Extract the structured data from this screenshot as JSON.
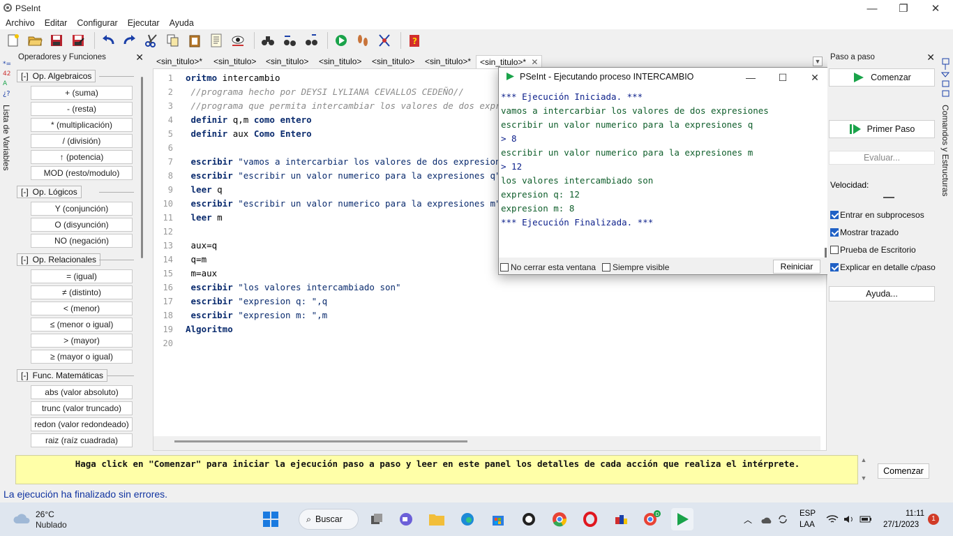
{
  "app": {
    "title": "PSeInt"
  },
  "menu": [
    "Archivo",
    "Editar",
    "Configurar",
    "Ejecutar",
    "Ayuda"
  ],
  "vars_panel": {
    "label": "Lista de Variables"
  },
  "ops_panel": {
    "title": "Operadores y Funciones",
    "groups": [
      {
        "label": "Op. Algebraicos",
        "toggle": "[-]",
        "items": [
          "+ (suma)",
          "- (resta)",
          "* (multiplicación)",
          "/ (división)",
          "↑ (potencia)",
          "MOD (resto/modulo)"
        ]
      },
      {
        "label": "Op. Lógicos",
        "toggle": "[-]",
        "items": [
          "Y (conjunción)",
          "O (disyunción)",
          "NO (negación)"
        ]
      },
      {
        "label": "Op. Relacionales",
        "toggle": "[-]",
        "items": [
          "= (igual)",
          "≠ (distinto)",
          "< (menor)",
          "≤ (menor o igual)",
          "> (mayor)",
          "≥ (mayor o igual)"
        ]
      },
      {
        "label": "Func. Matemáticas",
        "toggle": "[-]",
        "items": [
          "abs (valor absoluto)",
          "trunc (valor truncado)",
          "redon (valor redondeado)",
          "raiz (raíz cuadrada)"
        ]
      }
    ]
  },
  "tabs": [
    "<sin_titulo>*",
    "<sin_titulo>",
    "<sin_titulo>",
    "<sin_titulo>",
    "<sin_titulo>",
    "<sin_titulo>*",
    "<sin_titulo>*"
  ],
  "editor": {
    "line_numbers": [
      "1",
      "2",
      "3",
      "4",
      "5",
      "6",
      "7",
      "8",
      "9",
      "10",
      "11",
      "12",
      "13",
      "14",
      "15",
      "16",
      "17",
      "18",
      "19",
      "20"
    ],
    "lines": [
      [
        {
          "t": "oritmo",
          "c": "kw"
        },
        {
          "t": " intercambio",
          "c": ""
        }
      ],
      [
        {
          "t": " //programa hecho por DEYSI LYLIANA CEVALLOS CEDEÑO//",
          "c": "cm"
        }
      ],
      [
        {
          "t": " //programa que permita intercambiar los valores de dos expresiones",
          "c": "cm"
        }
      ],
      [
        {
          "t": " definir",
          "c": "kw"
        },
        {
          "t": " q,m ",
          "c": ""
        },
        {
          "t": "como entero",
          "c": "kw"
        }
      ],
      [
        {
          "t": " definir",
          "c": "kw"
        },
        {
          "t": " aux ",
          "c": ""
        },
        {
          "t": "Como Entero",
          "c": "kw"
        }
      ],
      [],
      [
        {
          "t": " escribir",
          "c": "kw"
        },
        {
          "t": " \"vamos a intercarbiar los valores de dos expresiones\"",
          "c": "str"
        }
      ],
      [
        {
          "t": " escribir",
          "c": "kw"
        },
        {
          "t": " \"escribir un valor numerico para la expresiones q\"",
          "c": "str"
        }
      ],
      [
        {
          "t": " leer",
          "c": "kw"
        },
        {
          "t": " q",
          "c": ""
        }
      ],
      [
        {
          "t": " escribir",
          "c": "kw"
        },
        {
          "t": " \"escribir un valor numerico para la expresiones m\"",
          "c": "str"
        }
      ],
      [
        {
          "t": " leer",
          "c": "kw"
        },
        {
          "t": " m",
          "c": ""
        }
      ],
      [],
      [
        {
          "t": " aux=q",
          "c": ""
        }
      ],
      [
        {
          "t": " q=m",
          "c": ""
        }
      ],
      [
        {
          "t": " m=aux",
          "c": ""
        }
      ],
      [
        {
          "t": " escribir",
          "c": "kw"
        },
        {
          "t": " \"los valores intercambiado son\"",
          "c": "str"
        }
      ],
      [
        {
          "t": " escribir",
          "c": "kw"
        },
        {
          "t": " \"expresion q: \",q",
          "c": "str"
        }
      ],
      [
        {
          "t": " escribir",
          "c": "kw"
        },
        {
          "t": " \"expresion m: \",m",
          "c": "str"
        }
      ],
      [
        {
          "t": "Algoritmo",
          "c": "kw"
        }
      ],
      []
    ]
  },
  "exec_window": {
    "title": "PSeInt - Ejecutando proceso INTERCAMBIO",
    "output": [
      {
        "t": "*** Ejecución Iniciada. ***",
        "c": "blue"
      },
      {
        "t": "vamos a intercarbiar los valores de dos expresiones",
        "c": "green"
      },
      {
        "t": "escribir un valor numerico para la expresiones q",
        "c": "green"
      },
      {
        "t": "> 8",
        "c": "blue"
      },
      {
        "t": "escribir un valor numerico para la expresiones m",
        "c": "green"
      },
      {
        "t": "> 12",
        "c": "blue"
      },
      {
        "t": "los valores intercambiado son",
        "c": "green"
      },
      {
        "t": "expresion q: 12",
        "c": "green"
      },
      {
        "t": "expresion m: 8",
        "c": "green"
      },
      {
        "t": "*** Ejecución Finalizada. ***",
        "c": "blue"
      }
    ],
    "no_cerrar": "No cerrar esta ventana",
    "siempre_visible": "Siempre visible",
    "reiniciar": "Reiniciar"
  },
  "step_panel": {
    "title": "Paso a paso",
    "comenzar": "Comenzar",
    "primer_paso": "Primer Paso",
    "evaluar": "Evaluar...",
    "velocidad": "Velocidad:",
    "options": [
      {
        "label": "Entrar en subprocesos",
        "checked": true
      },
      {
        "label": "Mostrar trazado",
        "checked": true
      },
      {
        "label": "Prueba de Escritorio",
        "checked": false
      },
      {
        "label": "Explicar en detalle c/paso",
        "checked": true
      }
    ],
    "ayuda": "Ayuda..."
  },
  "cmd_panel": {
    "label": "Comandos y Estructuras"
  },
  "help": {
    "text": "Haga click en \"Comenzar\" para iniciar la ejecución paso a paso y leer en este panel los detalles de cada acción que realiza el intérprete.",
    "button": "Comenzar"
  },
  "status": "La ejecución ha finalizado sin errores.",
  "taskbar": {
    "temp": "26°C",
    "weather": "Nublado",
    "search": "Buscar",
    "lang1": "ESP",
    "lang2": "LAA",
    "time": "11:11",
    "date": "27/1/2023",
    "notifications": "1"
  },
  "colors": {
    "accent": "#1f60c5",
    "help_bg": "#ffffa8",
    "status_text": "#1033a0"
  }
}
